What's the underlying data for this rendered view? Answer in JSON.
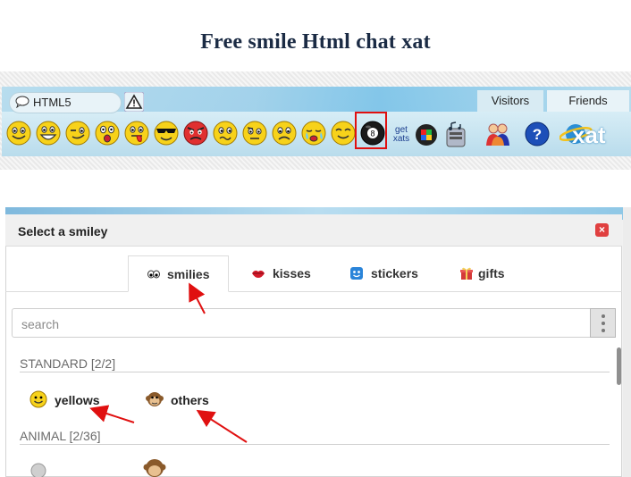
{
  "heading": "Free smile  Html chat xat",
  "chatbar": {
    "html5_label": "HTML5",
    "visitors_label": "Visitors",
    "friends_label": "Friends",
    "getxats_line1": "get",
    "getxats_line2": "xats",
    "logo_text": "xat",
    "smileys": [
      "smile",
      "grin",
      "wink",
      "shocked",
      "tongue",
      "cool",
      "angry",
      "confused",
      "unsure",
      "sad",
      "crying",
      "content",
      "8-ball"
    ]
  },
  "dialog": {
    "title": "Select a smiley",
    "tabs": [
      {
        "label": "smilies",
        "icon": "eyes-icon"
      },
      {
        "label": "kisses",
        "icon": "lips-icon"
      },
      {
        "label": "stickers",
        "icon": "sticker-icon"
      },
      {
        "label": "gifts",
        "icon": "gift-icon"
      }
    ],
    "search_placeholder": "search",
    "sections": [
      {
        "title": "STANDARD [2/2]",
        "items": [
          {
            "label": "yellows",
            "icon": "yellow-smiley-icon"
          },
          {
            "label": "others",
            "icon": "monkey-icon"
          }
        ]
      },
      {
        "title": "ANIMAL [2/36]",
        "items": []
      }
    ]
  },
  "colors": {
    "highlight": "#e01010",
    "arrow": "#e01010",
    "heading": "#1b2b44",
    "close": "#e04040"
  }
}
